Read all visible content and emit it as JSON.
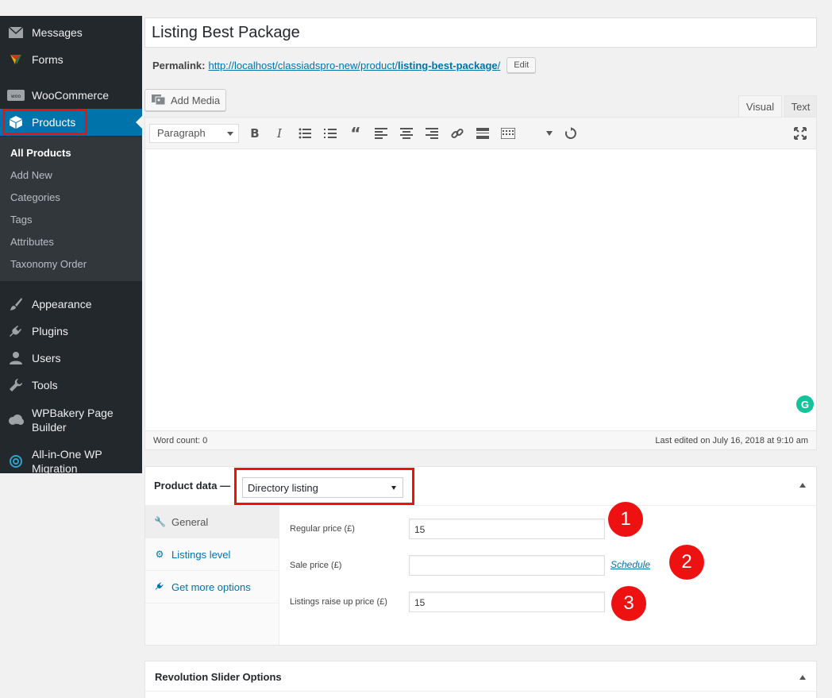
{
  "sidebar": {
    "items": [
      {
        "label": "Messages",
        "icon": "envelope-icon"
      },
      {
        "label": "Forms",
        "icon": "forms-icon"
      },
      {
        "label": "WooCommerce",
        "icon": "woocommerce-icon"
      },
      {
        "label": "Products",
        "icon": "products-box-icon"
      },
      {
        "label": "Appearance",
        "icon": "paintbrush-icon"
      },
      {
        "label": "Plugins",
        "icon": "plugin-icon"
      },
      {
        "label": "Users",
        "icon": "user-icon"
      },
      {
        "label": "Tools",
        "icon": "wrench-icon"
      },
      {
        "label": "WPBakery Page Builder",
        "icon": "cloud-icon"
      },
      {
        "label": "All-in-One WP Migration",
        "icon": "migration-icon"
      }
    ],
    "submenu": [
      "All Products",
      "Add New",
      "Categories",
      "Tags",
      "Attributes",
      "Taxonomy Order"
    ]
  },
  "post": {
    "title": "Listing Best Package",
    "permalink_label": "Permalink:",
    "permalink_base": "http://localhost/classiadspro-new/product/",
    "permalink_slug": "listing-best-package",
    "permalink_trail": "/",
    "edit_label": "Edit"
  },
  "editor": {
    "add_media": "Add Media",
    "tab_visual": "Visual",
    "tab_text": "Text",
    "format_select": "Paragraph",
    "word_count": "Word count: 0",
    "last_edited": "Last edited on July 16, 2018 at 9:10 am"
  },
  "product_data": {
    "title": "Product data —",
    "type_select": "Directory listing",
    "tabs": [
      "General",
      "Listings level",
      "Get more options"
    ],
    "fields": [
      {
        "label": "Regular price (£)",
        "value": "15"
      },
      {
        "label": "Sale price (£)",
        "value": ""
      },
      {
        "label": "Listings raise up price (£)",
        "value": "15"
      }
    ],
    "schedule_link": "Schedule",
    "badges": [
      "1",
      "2",
      "3"
    ]
  },
  "revolution_slider": {
    "title": "Revolution Slider Options"
  },
  "colors": {
    "sidebar_bg": "#23282d",
    "active_blue": "#0073aa",
    "highlight_red": "#ee1111"
  }
}
